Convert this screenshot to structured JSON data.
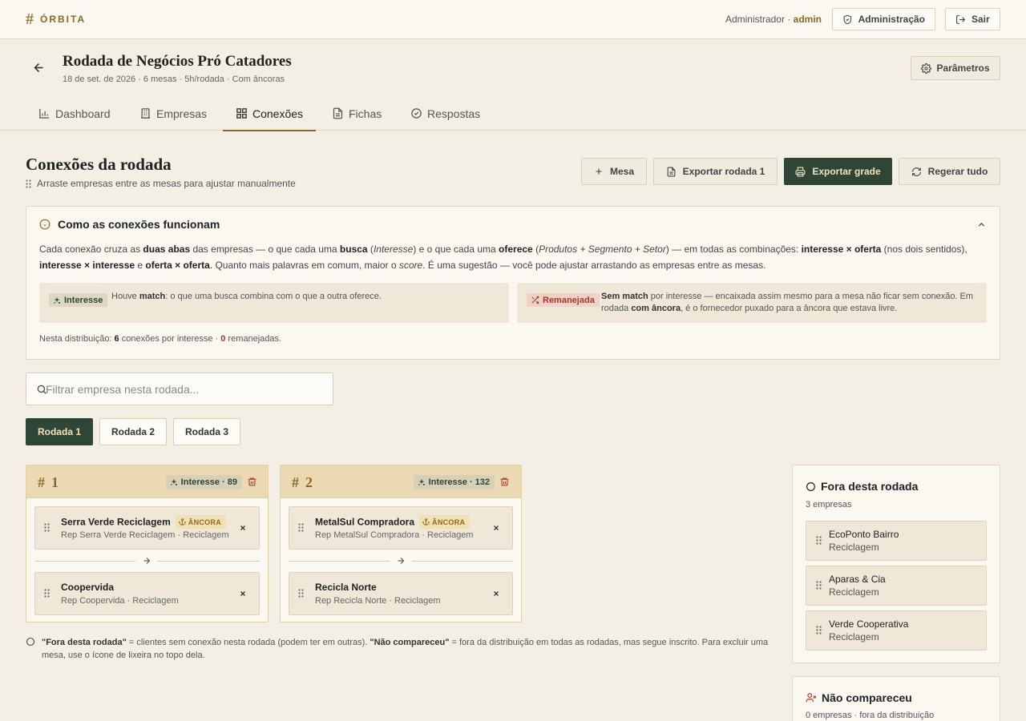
{
  "app": {
    "logo_symbol": "#",
    "name": "ÓRBITA",
    "brand_color": "#8a6a22",
    "accent_dark": "#2e4537"
  },
  "user": {
    "role": "Administrador",
    "separator": " · ",
    "username": "admin"
  },
  "topbar": {
    "admin_label": "Administração",
    "logout_label": "Sair"
  },
  "event": {
    "title": "Rodada de Negócios Pró Catadores",
    "subtitle": "18 de set. de 2026 · 6 mesas · 5h/rodada · Com âncoras",
    "params_label": "Parâmetros"
  },
  "tabs": [
    {
      "label": "Dashboard",
      "icon": "bar-chart-icon"
    },
    {
      "label": "Empresas",
      "icon": "building-icon"
    },
    {
      "label": "Conexões",
      "icon": "grid-icon",
      "active": true
    },
    {
      "label": "Fichas",
      "icon": "file-icon"
    },
    {
      "label": "Respostas",
      "icon": "check-circle-icon"
    }
  ],
  "section": {
    "title": "Conexões da rodada",
    "subtitle": "Arraste empresas entre as mesas para ajustar manualmente"
  },
  "actions": {
    "add_table": "Mesa",
    "export_round": "Exportar rodada 1",
    "export_grid": "Exportar grade",
    "regenerate": "Regerar tudo"
  },
  "info": {
    "title": "Como as conexões funcionam",
    "p": {
      "t1": "Cada conexão cruza as ",
      "b1": "duas abas",
      "t2": " das empresas — o que cada uma ",
      "b2": "busca",
      "t3": " (",
      "i1": "Interesse",
      "t4": ") e o que cada uma ",
      "b3": "oferece",
      "t5": " (",
      "i2": "Produtos + Segmento + Setor",
      "t6": ") — em todas as combinações: ",
      "b4": "interesse × oferta",
      "t7": " (nos dois sentidos), ",
      "b5": "interesse × interesse",
      "t8": " e ",
      "b6": "oferta × oferta",
      "t9": ". Quanto mais palavras em comum, maior o ",
      "i3": "score",
      "t10": ". É uma sugestão — você pode ajustar arrastando as empresas entre as mesas."
    },
    "legend": {
      "interest": {
        "badge": "Interesse",
        "t1": "Houve ",
        "b1": "match",
        "t2": ": o que uma busca combina com o que a outra oferece."
      },
      "relocated": {
        "badge": "Remanejada",
        "b1": "Sem match",
        "t1": " por interesse — encaixada assim mesmo para a mesa não ficar sem conexão. Em rodada ",
        "b2": "com âncora",
        "t2": ", é o fornecedor puxado para a âncora que estava livre."
      }
    },
    "stats": {
      "prefix": "Nesta distribuição: ",
      "interest_count": "6",
      "mid": " conexões por interesse · ",
      "relocated_count": "0",
      "suffix": " remanejadas."
    }
  },
  "search": {
    "placeholder": "Filtrar empresa nesta rodada..."
  },
  "rounds": [
    {
      "label": "Rodada 1",
      "active": true
    },
    {
      "label": "Rodada 2"
    },
    {
      "label": "Rodada 3"
    }
  ],
  "anchor_label": "ÂNCORA",
  "tables": [
    {
      "symbol": "#",
      "number": "1",
      "badge": "Interesse · 89",
      "anchor": {
        "name": "Serra Verde Reciclagem",
        "sub": "Rep Serra Verde Reciclagem · Reciclagem"
      },
      "guest": {
        "name": "Coopervida",
        "sub": "Rep Coopervida · Reciclagem"
      }
    },
    {
      "symbol": "#",
      "number": "2",
      "badge": "Interesse · 132",
      "anchor": {
        "name": "MetalSul Compradora",
        "sub": "Rep MetalSul Compradora · Reciclagem"
      },
      "guest": {
        "name": "Recicla Norte",
        "sub": "Rep Recicla Norte · Reciclagem"
      }
    }
  ],
  "note": {
    "b1": "\"Fora desta rodada\"",
    "t1": " = clientes sem conexão nesta rodada (podem ter em outras). ",
    "b2": "\"Não compareceu\"",
    "t2": " = fora da distribuição em todas as rodadas, mas segue inscrito. Para excluir uma mesa, use o ícone de lixeira no topo dela."
  },
  "outside": {
    "title": "Fora desta rodada",
    "count": "3 empresas",
    "items": [
      {
        "name": "EcoPonto Bairro",
        "sub": "Reciclagem"
      },
      {
        "name": "Aparas & Cia",
        "sub": "Reciclagem"
      },
      {
        "name": "Verde Cooperativa",
        "sub": "Reciclagem"
      }
    ]
  },
  "absent": {
    "title": "Não compareceu",
    "count": "0 empresas · fora da distribuição"
  }
}
